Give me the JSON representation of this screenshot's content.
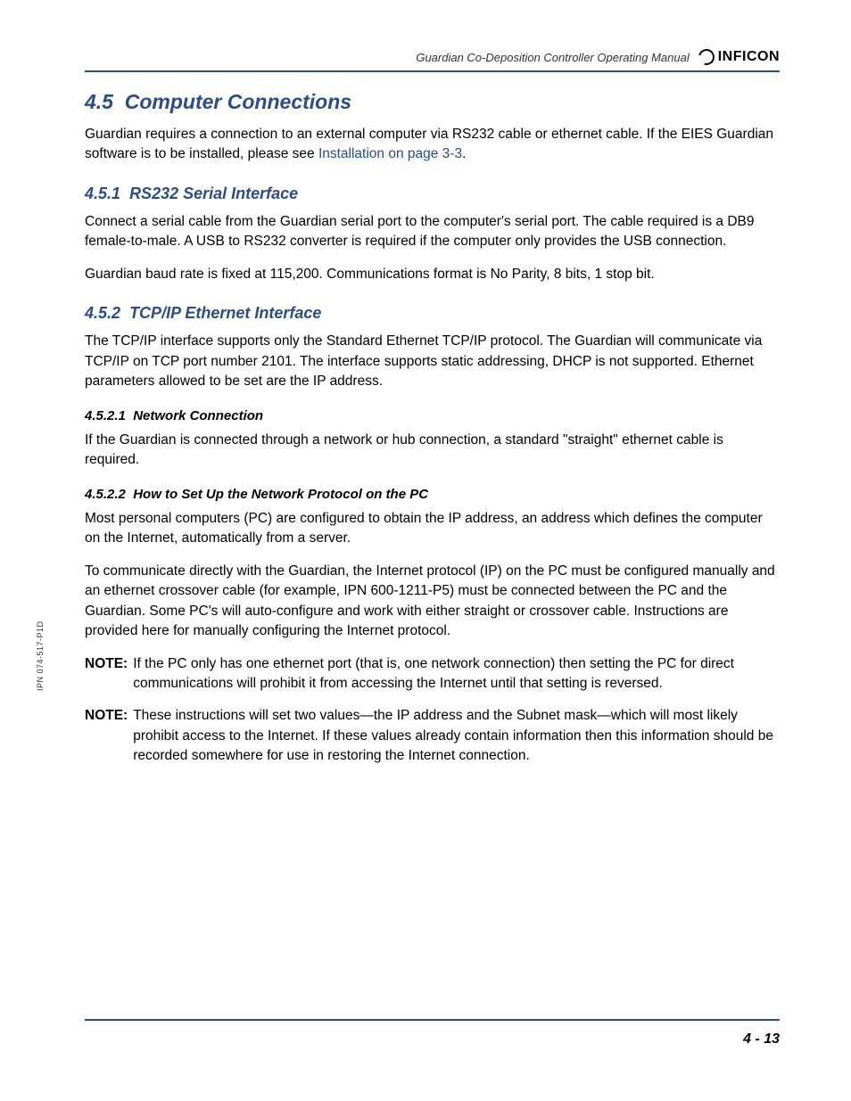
{
  "header": {
    "manual_title": "Guardian Co-Deposition Controller Operating Manual",
    "brand": "INFICON"
  },
  "side_label": "IPN 074-517-P1D",
  "page_number": "4 - 13",
  "section": {
    "number": "4.5",
    "title": "Computer Connections",
    "intro_pre": "Guardian requires a connection to an external computer via RS232 cable or ethernet cable. If the EIES Guardian software is to be installed, please see ",
    "intro_link": "Installation on page 3-3",
    "intro_post": "."
  },
  "sub1": {
    "number": "4.5.1",
    "title": "RS232 Serial Interface",
    "p1": "Connect a serial cable from the Guardian serial port to the computer's serial port. The cable required is a DB9 female-to-male. A USB to RS232 converter is required if the computer only provides the USB connection.",
    "p2": "Guardian baud rate is fixed at 115,200. Communications format is No Parity, 8 bits, 1 stop bit."
  },
  "sub2": {
    "number": "4.5.2",
    "title": "TCP/IP Ethernet Interface",
    "p1": "The TCP/IP interface supports only the Standard Ethernet TCP/IP protocol. The Guardian will communicate via TCP/IP on TCP port number 2101. The interface supports static addressing, DHCP is not supported. Ethernet parameters allowed to be set are the IP address."
  },
  "sub2_1": {
    "number": "4.5.2.1",
    "title": "Network Connection",
    "p1": "If the Guardian is connected through a network or hub connection, a standard \"straight\" ethernet cable is required."
  },
  "sub2_2": {
    "number": "4.5.2.2",
    "title": "How to Set Up the Network Protocol on the PC",
    "p1": "Most personal computers (PC) are configured to obtain the IP address, an address which defines the computer on the Internet, automatically from a server.",
    "p2": "To communicate directly with the Guardian, the Internet protocol (IP) on the PC must be configured manually and an ethernet crossover cable (for example, IPN 600-1211-P5) must be connected between the PC and the Guardian. Some PC's will auto-configure and work with either straight or crossover cable. Instructions are provided here for manually configuring the Internet protocol.",
    "note_label": "NOTE:",
    "note1": "If the PC only has one ethernet port (that is, one network connection) then setting the PC for direct communications will prohibit it from accessing the Internet until that setting is reversed.",
    "note2": "These instructions will set two values—the IP address and the Subnet mask—which will most likely prohibit access to the Internet. If these values already contain information then this information should be recorded somewhere for use in restoring the Internet connection."
  }
}
